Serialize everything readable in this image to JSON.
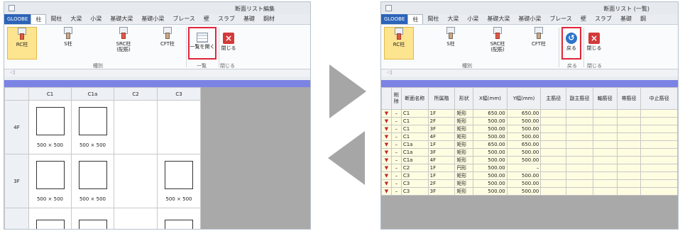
{
  "left": {
    "title": "断面リスト編集",
    "tabs": [
      "GLOOBE",
      "柱",
      "間柱",
      "大梁",
      "小梁",
      "基礎大梁",
      "基礎小梁",
      "ブレース",
      "壁",
      "スラブ",
      "基礎",
      "鋼材"
    ],
    "buttons": {
      "rc": "RC柱",
      "s": "S柱",
      "src": "SRC柱\n(配筋)",
      "cft": "CFT柱",
      "open": "一覧を開く",
      "close": "閉じる"
    },
    "groups": {
      "type": "種別",
      "list": "一覧",
      "close": "閉じる"
    },
    "columns": [
      "C1",
      "C1a",
      "C2",
      "C3"
    ],
    "rows": [
      {
        "floor": "4F",
        "cells": [
          "500 × 500",
          "500 × 500",
          "",
          ""
        ]
      },
      {
        "floor": "3F",
        "cells": [
          "500 × 500",
          "500 × 500",
          "",
          "500 × 500"
        ]
      },
      {
        "floor": "",
        "cells": [
          "",
          "",
          "",
          ""
        ]
      }
    ]
  },
  "right": {
    "title": "断面リスト (一覧)",
    "tabs": [
      "GLOOBE",
      "柱",
      "間柱",
      "大梁",
      "小梁",
      "基礎大梁",
      "基礎小梁",
      "ブレース",
      "壁",
      "スラブ",
      "基礎",
      "鋼"
    ],
    "buttons": {
      "rc": "RC柱",
      "s": "S柱",
      "src": "SRC柱\n(配筋)",
      "cft": "CFT柱",
      "back": "戻る",
      "close": "閉じる"
    },
    "groups": {
      "type": "種別",
      "back": "戻る",
      "close": "閉じる"
    },
    "headers": [
      "削除",
      "断面名称",
      "所属階",
      "形状",
      "X幅(mm)",
      "Y幅(mm)",
      "主筋径",
      "副主筋径",
      "軸筋径",
      "帯筋径",
      "中止筋径"
    ],
    "rows": [
      {
        "del": "–",
        "name": "C1",
        "floor": "1F",
        "shape": "矩形",
        "x": "650.00",
        "y": "650.00"
      },
      {
        "del": "–",
        "name": "C1",
        "floor": "2F",
        "shape": "矩形",
        "x": "500.00",
        "y": "500.00"
      },
      {
        "del": "–",
        "name": "C1",
        "floor": "3F",
        "shape": "矩形",
        "x": "500.00",
        "y": "500.00"
      },
      {
        "del": "–",
        "name": "C1",
        "floor": "4F",
        "shape": "矩形",
        "x": "500.00",
        "y": "500.00"
      },
      {
        "del": "–",
        "name": "C1a",
        "floor": "1F",
        "shape": "矩形",
        "x": "650.00",
        "y": "650.00"
      },
      {
        "del": "–",
        "name": "C1a",
        "floor": "3F",
        "shape": "矩形",
        "x": "500.00",
        "y": "500.00"
      },
      {
        "del": "–",
        "name": "C1a",
        "floor": "4F",
        "shape": "矩形",
        "x": "500.00",
        "y": "500.00"
      },
      {
        "del": "–",
        "name": "C2",
        "floor": "1F",
        "shape": "円形",
        "x": "500.00",
        "y": "–"
      },
      {
        "del": "–",
        "name": "C3",
        "floor": "1F",
        "shape": "矩形",
        "x": "500.00",
        "y": "500.00"
      },
      {
        "del": "–",
        "name": "C3",
        "floor": "2F",
        "shape": "矩形",
        "x": "500.00",
        "y": "500.00"
      },
      {
        "del": "–",
        "name": "C3",
        "floor": "3F",
        "shape": "矩形",
        "x": "500.00",
        "y": "500.00"
      }
    ]
  },
  "colors": {
    "accent": "#2c64b8",
    "highlight": "#e0263a",
    "arrow": "#a6a6a6",
    "bluebar": "#7b83e4",
    "list_bg": "#fffde1"
  }
}
